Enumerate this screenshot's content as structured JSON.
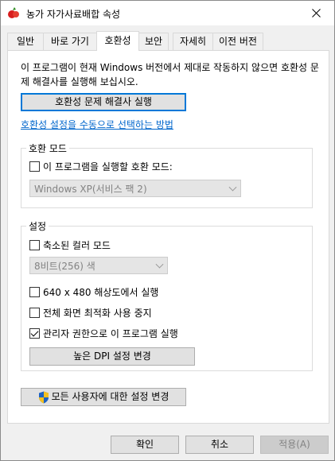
{
  "window": {
    "title": "농가 자가사료배합 속성"
  },
  "tabs": [
    {
      "label": "일반"
    },
    {
      "label": "바로 가기"
    },
    {
      "label": "호환성"
    },
    {
      "label": "보안"
    },
    {
      "label": "자세히"
    },
    {
      "label": "이전 버전"
    }
  ],
  "compat": {
    "description": "이 프로그램이 현재 Windows 버전에서 제대로 작동하지 않으면 호환성 문제 해결사를 실행해 보십시오.",
    "troubleshooter_button": "호환성 문제 해결사 실행",
    "manual_link": "호환성 설정을 수동으로 선택하는 방법"
  },
  "mode_group": {
    "label": "호환 모드",
    "checkbox_label": "이 프로그램을 실행할 호환 모드:",
    "checked": false,
    "os_select": "Windows XP(서비스 팩 2)"
  },
  "settings_group": {
    "label": "설정",
    "reduced_color": {
      "label": "축소된 컬러 모드",
      "checked": false
    },
    "color_select": "8비트(256) 색",
    "res_640": {
      "label": "640 x 480 해상도에서 실행",
      "checked": false
    },
    "disable_fullscreen": {
      "label": "전체 화면 최적화 사용 중지",
      "checked": false
    },
    "run_as_admin": {
      "label": "관리자 권한으로 이 프로그램 실행",
      "checked": true
    },
    "dpi_button": "높은 DPI 설정 변경"
  },
  "all_users_button": "모든 사용자에 대한 설정 변경",
  "footer": {
    "ok": "확인",
    "cancel": "취소",
    "apply": "적용(A)"
  },
  "colors": {
    "accent": "#0078d7",
    "link": "#0066cc",
    "disabled_text": "#838383"
  }
}
